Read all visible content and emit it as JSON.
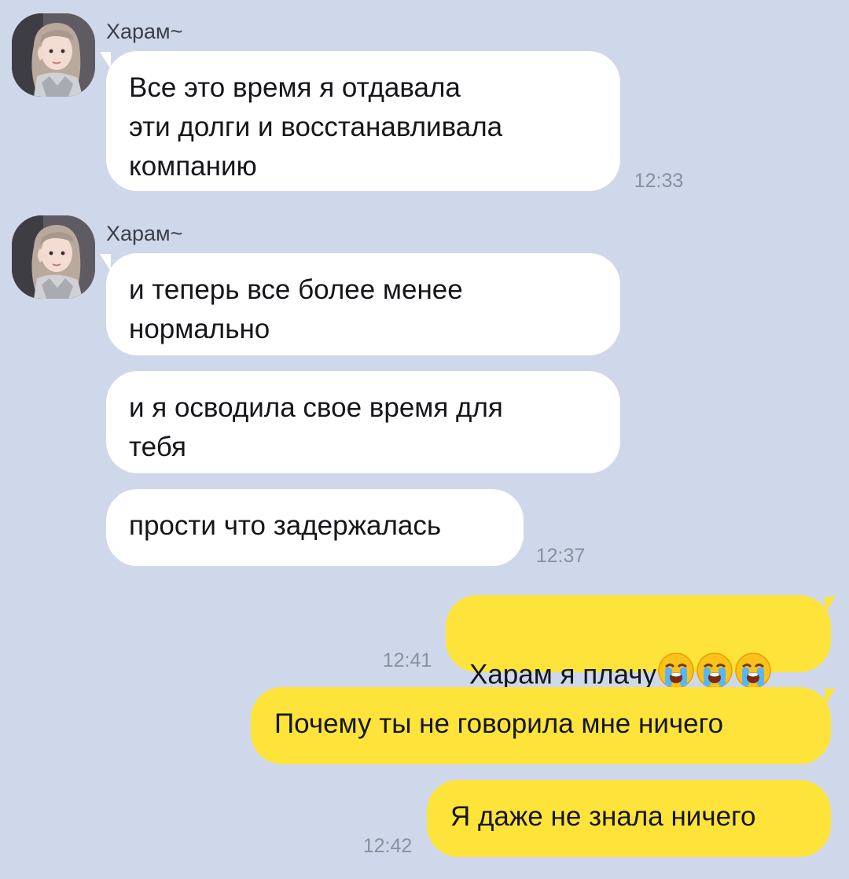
{
  "sender": {
    "name": "Харам~"
  },
  "messages": [
    {
      "text": "Все это время я отдавала\nэти долги и восстанавливала\nкомпанию",
      "time": "12:33"
    },
    {
      "text": "и теперь все более менее\nнормально"
    },
    {
      "text": "и я осводила свое время для\nтебя"
    },
    {
      "text": "прости что задержалась",
      "time": "12:37"
    },
    {
      "text": "Харам я плачу",
      "emoji": [
        "loudly-crying-face-icon",
        "loudly-crying-face-icon",
        "loudly-crying-face-icon"
      ],
      "time": "12:41"
    },
    {
      "text": "Почему ты не говорила мне ничего"
    },
    {
      "text": "Я даже не знала ничего",
      "time": "12:42"
    }
  ],
  "colors": {
    "background": "#cfd7ea",
    "incoming_bubble": "#ffffff",
    "outgoing_bubble": "#fee43a",
    "timestamp": "#8a909d"
  }
}
